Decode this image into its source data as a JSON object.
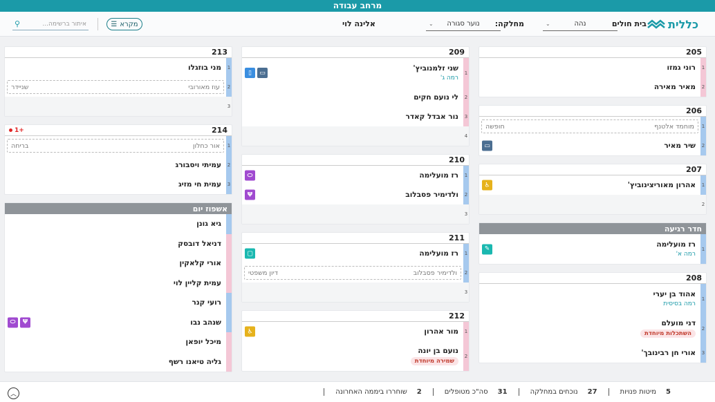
{
  "app": {
    "title": "מרחב עבודה"
  },
  "header": {
    "logo_text": "כללית",
    "hospital_label": "בית חולים",
    "hospital_value": "נהה",
    "department_label": "מחלקה:",
    "department_value": "נוער סגורה",
    "user_name": "אלינה לוי",
    "legend_label": "מקרא",
    "search_placeholder": "איתור ברשימה..."
  },
  "rooms": {
    "r205": {
      "number": "205",
      "beds": [
        "רוני גמזו",
        "מאיר מאירה"
      ]
    },
    "r206": {
      "number": "206",
      "bed1_left": "מוחמד אלטנף",
      "bed1_right": "חופשה",
      "bed2": "שיר מאיר"
    },
    "r207": {
      "number": "207",
      "bed1": "אהרון מאוריצינוביץ'",
      "bed2_num": "2"
    },
    "recovery": {
      "title": "חדר רגיעה",
      "name": "רז מועלימה",
      "sub": "רמה א'"
    },
    "r208": {
      "number": "208",
      "bed1": "אהוד בן יערי",
      "bed1_sub": "רמה בסיסית",
      "bed2": "דני מועלם",
      "bed2_tag": "השתכלות מיוחדת",
      "bed3": "אורי חן רבינובך'"
    },
    "r209": {
      "number": "209",
      "bed1": "שני זלמנוביץ'",
      "bed1_sub": "רמה ג'",
      "bed2": "לי נועם חקים",
      "bed3": "נור אבדל קאדר",
      "bed4_num": "4"
    },
    "r210": {
      "number": "210",
      "bed1": "רז מועלימה",
      "bed2": "ולדימיר פסבלוב",
      "bed3_num": "3"
    },
    "r211": {
      "number": "211",
      "bed1": "רז מועלימה",
      "bed2_left": "ולדימיר פסבלוב",
      "bed2_right": "דיון משפטי",
      "bed3_num": "3"
    },
    "r212": {
      "number": "212",
      "bed1": "מור אהרון",
      "bed2": "נועם בן יונה",
      "bed2_tag": "שמירה מיוחדת"
    },
    "r213": {
      "number": "213",
      "bed1": "מני בוזגלו",
      "bed2_left": "עוז מאורובי",
      "bed2_right": "שניידר",
      "bed3_num": "3"
    },
    "r214": {
      "number": "214",
      "plus": "+1",
      "bed1_left": "אור כחלון",
      "bed1_right": "בריחה",
      "bed2": "עמיתי ויסבורג",
      "bed3": "עמית חי מזיג"
    },
    "day": {
      "title": "אשפוז יום",
      "patients": [
        "גיא גונן",
        "דניאל דובסק",
        "אורי קלאקין",
        "עמית קליין לוי",
        "רועי קנר",
        "שנהב נבו",
        "מיכל יופאן",
        "גליה טיאנו רשף"
      ]
    }
  },
  "bed_numbers": [
    "1",
    "2",
    "3"
  ],
  "footer": {
    "stats": [
      {
        "label": "מיטות פנויות",
        "value": "5"
      },
      {
        "label": "נוכחים במחלקה",
        "value": "27"
      },
      {
        "label": "סה\"כ מטופלים",
        "value": "31"
      },
      {
        "label": "שוחררו ביממה האחרונה",
        "value": "2"
      }
    ]
  },
  "colors": {
    "teal": "#1b9aa8",
    "bed_blue": "#a6c9ee",
    "bed_pink": "#f4c7d6"
  },
  "icons": [
    "search-icon",
    "legend-list-icon",
    "chevron-down-icon",
    "pill-icon",
    "food-icon",
    "wheelchair-icon",
    "tablet-icon",
    "pen-icon",
    "monitor-icon",
    "bottle-icon",
    "chevron-up-icon"
  ]
}
